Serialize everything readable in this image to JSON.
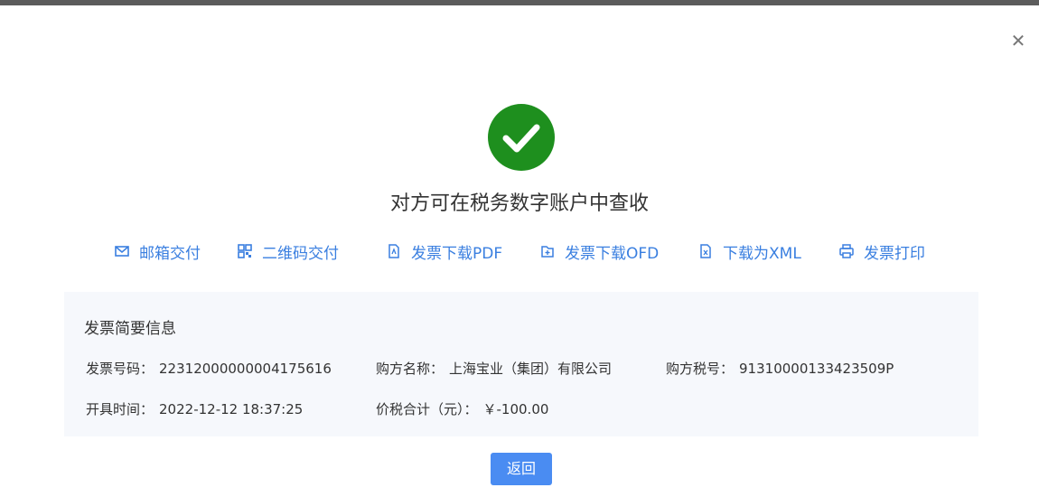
{
  "dialog": {
    "close_icon": "close-icon",
    "status_icon": "check-circle-icon",
    "status_color": "#1e8f1e",
    "heading": "对方可在税务数字账户中查收"
  },
  "actions": [
    {
      "label": "邮箱交付",
      "icon": "mail-icon"
    },
    {
      "label": "二维码交付",
      "icon": "qrcode-icon"
    },
    {
      "label": "发票下载PDF",
      "icon": "pdf-file-icon"
    },
    {
      "label": "发票下载OFD",
      "icon": "ofd-file-icon"
    },
    {
      "label": "下载为XML",
      "icon": "xml-file-icon"
    },
    {
      "label": "发票打印",
      "icon": "printer-icon"
    }
  ],
  "summary": {
    "title": "发票简要信息",
    "invoice_no_label": "发票号码：",
    "invoice_no": "22312000000004175616",
    "buyer_name_label": "购方名称：",
    "buyer_name": "上海宝业（集团）有限公司",
    "buyer_tax_label": "购方税号：",
    "buyer_tax": "91310000133423509P",
    "issue_time_label": "开具时间：",
    "issue_time": "2022-12-12 18:37:25",
    "total_label": "价税合计（元）：",
    "total": "￥-100.00"
  },
  "footer": {
    "back_label": "返回"
  },
  "colors": {
    "accent": "#3a7fe0",
    "button": "#4a8cf2",
    "panel_bg": "#f6f8fc"
  }
}
